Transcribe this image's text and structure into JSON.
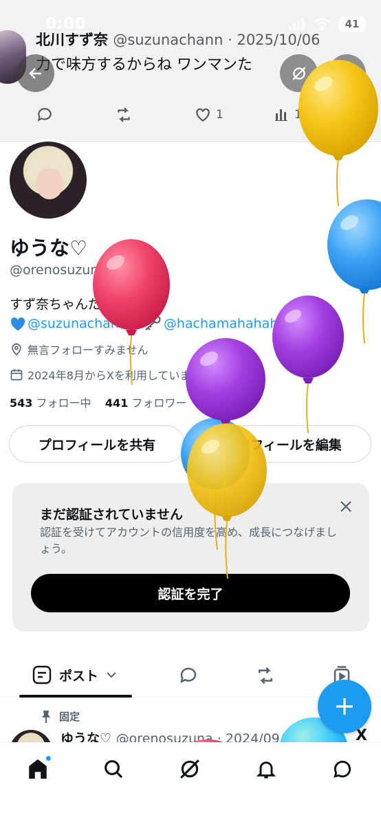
{
  "status_bar": {
    "time": "0:00",
    "battery": "41"
  },
  "background_tweet": {
    "name": "北川すず奈",
    "handle": "@suzunachann",
    "date": "2025/10/06",
    "text": "力で味方するからね ワンマンた",
    "likes": "1",
    "views": "169"
  },
  "profile": {
    "display_name": "ゆうな♡",
    "handle": "@orenosuzuna",
    "bio_line1": "すず奈ちゃんだーいすき",
    "bio_mention1": "@suzunachann",
    "bio_slash": "／",
    "bio_mention2": "@hachamahahaha",
    "location": "無言フォローすみません",
    "joined": "2024年8月からXを利用しています",
    "following_count": "543",
    "following_label": "フォロー中",
    "followers_count": "441",
    "followers_label": "フォロワー",
    "share_button": "プロフィールを共有",
    "edit_button": "プロフィールを編集"
  },
  "verify_card": {
    "title": "まだ認証されていません",
    "description": "認証を受けてアカウントの信用度を高め、成長につなげましょう。",
    "button": "認証を完了"
  },
  "tabs": {
    "posts_label": "ポスト"
  },
  "pinned_post": {
    "pinned_label": "固定",
    "name": "ゆうな♡",
    "handle": "@orenosuzuna",
    "date": "2024/09/",
    "x_mark": "X"
  },
  "balloon_colors": {
    "yellow": "#f5c518",
    "blue": "#3ba2f5",
    "red": "#f0436a",
    "purple": "#a23ee0",
    "accent": "#1d9bf0"
  }
}
